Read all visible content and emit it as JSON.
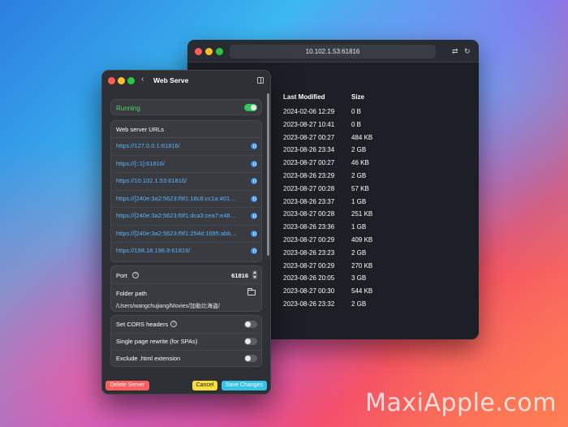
{
  "browser": {
    "url": "10.102.1.53:61816",
    "columns": {
      "last_modified": "Last Modified",
      "size": "Size"
    },
    "rows": [
      {
        "modified": "2024-02-06 12:29",
        "size": "0 B"
      },
      {
        "modified": "2023-08-27 10:41",
        "size": "0 B"
      },
      {
        "modified": "2023-08-27 00:27",
        "size": "484 KB"
      },
      {
        "modified": "2023-08-26 23:34",
        "size": "2 GB"
      },
      {
        "modified": "2023-08-27 00:27",
        "size": "46 KB"
      },
      {
        "modified": "2023-08-26 23:29",
        "size": "2 GB"
      },
      {
        "modified": "2023-08-27 00:28",
        "size": "57 KB"
      },
      {
        "modified": "2023-08-26 23:37",
        "size": "1 GB"
      },
      {
        "modified": "2023-08-27 00:28",
        "size": "251 KB"
      },
      {
        "modified": "2023-08-26 23:36",
        "size": "1 GB"
      },
      {
        "modified": "2023-08-27 00:29",
        "size": "409 KB"
      },
      {
        "modified": "2023-08-26 23:23",
        "size": "2 GB"
      },
      {
        "modified": "2023-08-27 00:29",
        "size": "270 KB"
      },
      {
        "modified": "2023-08-26 20:05",
        "size": "3 GB"
      },
      {
        "modified": "2023-08-27 00:30",
        "size": "544 KB"
      },
      {
        "modified": "2023-08-26 23:32",
        "size": "2 GB"
      }
    ]
  },
  "panel": {
    "title": "Web Serve",
    "status": {
      "label": "Running",
      "enabled": true
    },
    "urls_label": "Web server URLs",
    "urls": [
      "https://127.0.0.1:61816/",
      "https://[::1]:61816/",
      "https://10.102.1.53:61816/",
      "https://[240e:3a2:5623:f9f1:18c8:cc1a:401…",
      "https://[240e:3a2:5623:f9f1:dca3:cea7:e48…",
      "https://[240e:3a2:5623:f9f1:254d:1695:abb…",
      "https://198.18.196.9:61816/"
    ],
    "port_label": "Port",
    "port_value": "61816",
    "folder_label": "Folder path",
    "folder_path": "/Users/wangchujiang/Movies/加勒比海盗/",
    "options": [
      {
        "label": "Set CORS headers",
        "has_help": true,
        "enabled": false
      },
      {
        "label": "Single page rewrite (for SPAs)",
        "has_help": false,
        "enabled": false
      },
      {
        "label": "Exclude .html extension",
        "has_help": false,
        "enabled": false
      }
    ],
    "buttons": {
      "delete": "Delete Server",
      "cancel": "Cancel",
      "save": "Save Changes"
    }
  },
  "watermark": "MaxiApple.com"
}
